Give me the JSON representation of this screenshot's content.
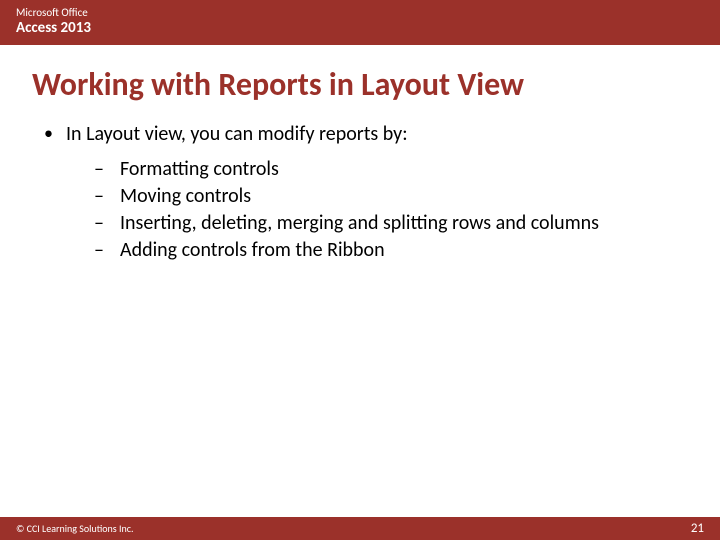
{
  "header": {
    "line1": "Microsoft Office",
    "line2": "Access 2013"
  },
  "title": "Working with Reports in Layout View",
  "main_bullet": "In Layout view, you can modify reports by:",
  "sub_items": [
    "Formatting controls",
    "Moving controls",
    "Inserting, deleting, merging and splitting rows and columns",
    "Adding controls from the Ribbon"
  ],
  "footer": {
    "copyright": "© CCI Learning Solutions Inc.",
    "page_number": "21"
  }
}
